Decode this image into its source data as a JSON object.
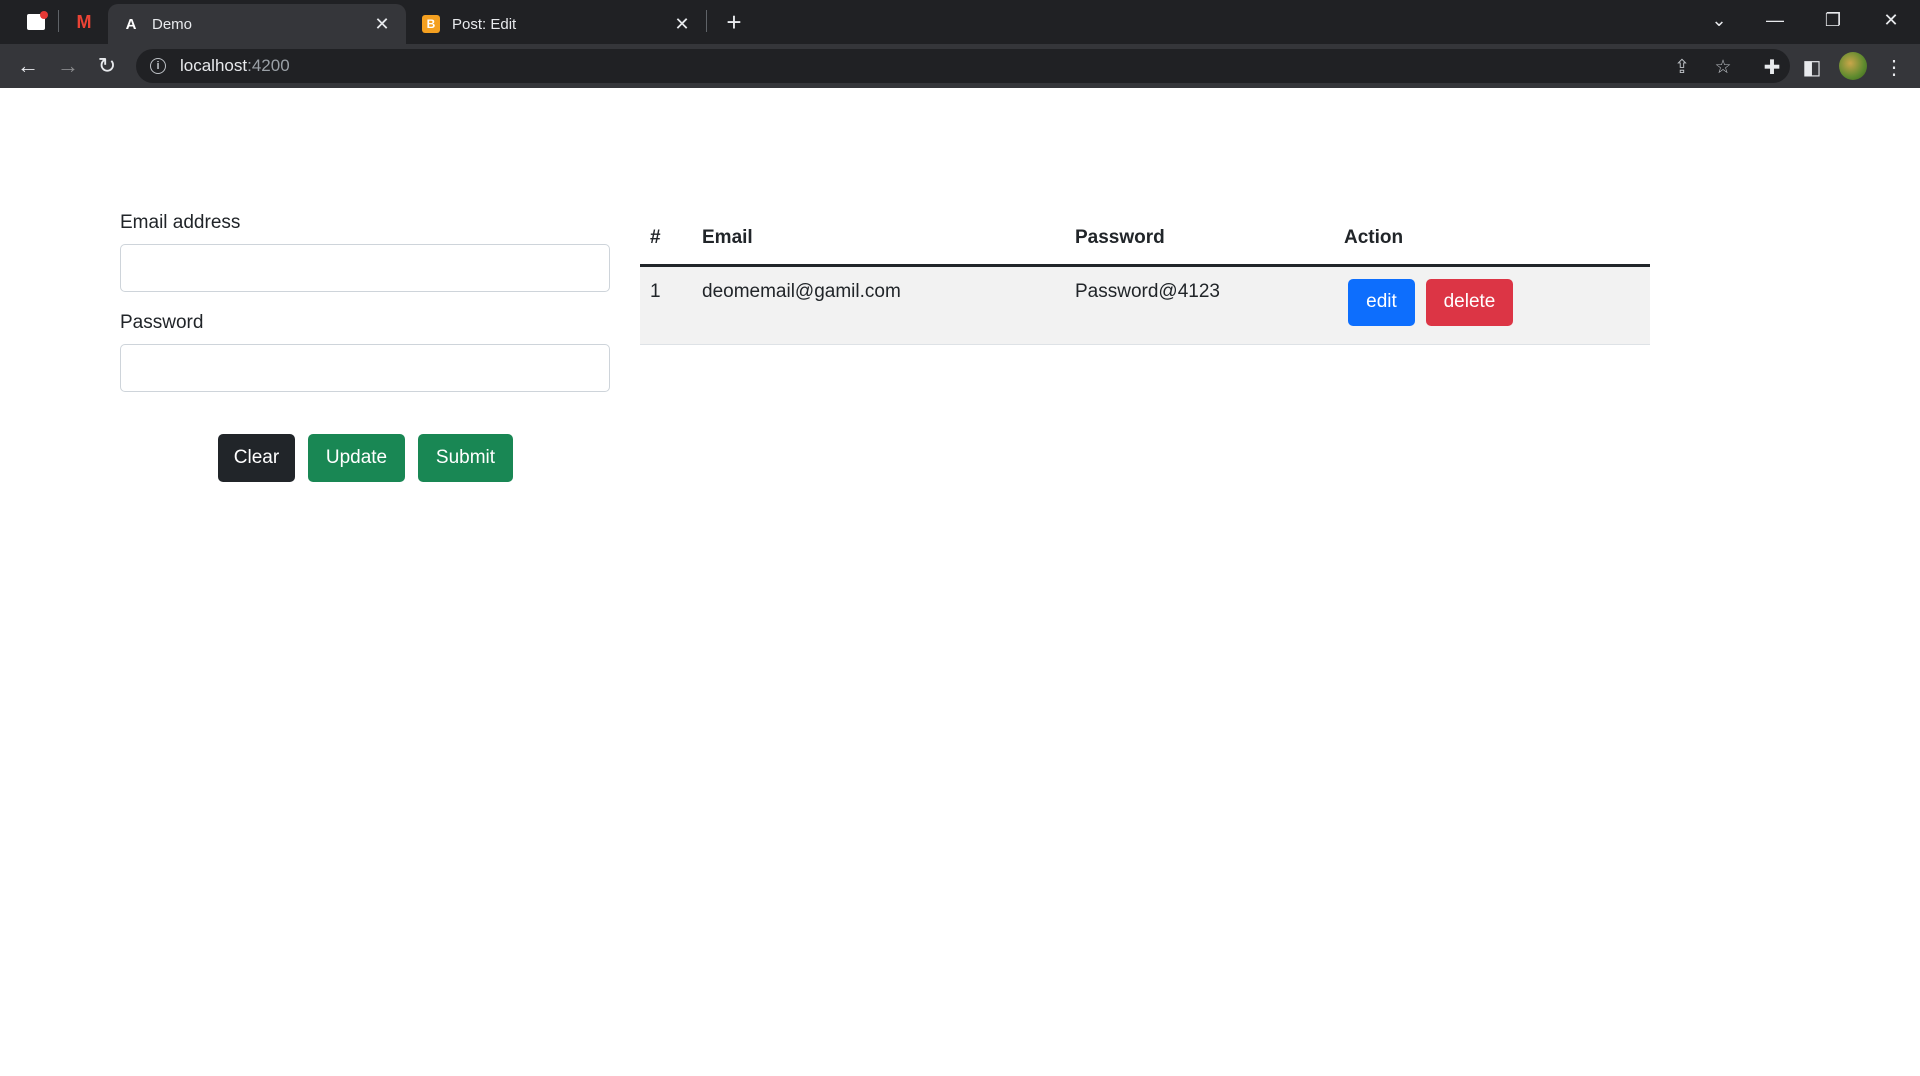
{
  "browser": {
    "tabs": [
      {
        "title": "Demo",
        "favicon": "angular-icon",
        "active": true
      },
      {
        "title": "Post: Edit",
        "favicon": "blogger-icon",
        "active": false
      }
    ],
    "address": {
      "host": "localhost",
      "port": ":4200"
    }
  },
  "form": {
    "email_label": "Email address",
    "email_value": "",
    "password_label": "Password",
    "password_value": "",
    "clear_label": "Clear",
    "update_label": "Update",
    "submit_label": "Submit"
  },
  "table": {
    "headers": [
      "#",
      "Email",
      "Password",
      "Action"
    ],
    "rows": [
      {
        "index": "1",
        "email": "deomemail@gamil.com",
        "password": "Password@4123",
        "edit_label": "edit",
        "delete_label": "delete"
      }
    ]
  },
  "colors": {
    "primary": "#0d6efd",
    "danger": "#dc3545",
    "success": "#198754",
    "dark": "#212529"
  }
}
